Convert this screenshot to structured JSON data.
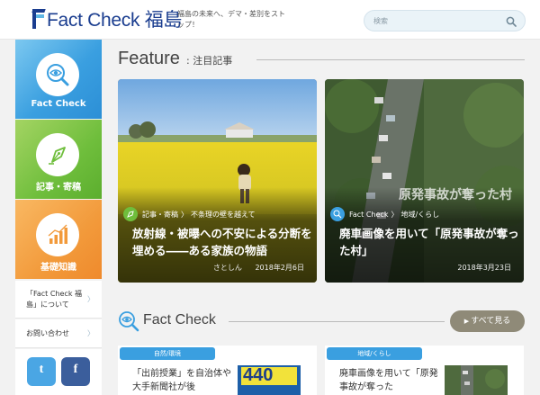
{
  "header": {
    "logo_text": "Fact Check 福島",
    "tagline": "福島の未来へ、デマ・差別をストップ！",
    "search_placeholder": "検索",
    "icons": {
      "search": "search-icon"
    }
  },
  "sidebar": {
    "categories": [
      {
        "label": "Fact Check",
        "icon": "magnifier-eye-icon",
        "color": "#3a9fe0"
      },
      {
        "label": "記事・寄稿",
        "icon": "pen-nib-icon",
        "color": "#6fbe3c"
      },
      {
        "label": "基礎知識",
        "icon": "bar-chart-icon",
        "color": "#f29a3b"
      }
    ],
    "links": [
      {
        "label": "「Fact Check 福島」について",
        "icon": "chevron-right-icon"
      },
      {
        "label": "お問い合わせ",
        "icon": "chevron-right-icon"
      }
    ],
    "social": {
      "twitter": "t",
      "facebook": "f"
    }
  },
  "feature": {
    "title_en": "Feature",
    "title_jp": ": 注目記事",
    "cards": [
      {
        "category": "記事・寄稿",
        "separator": "〉",
        "subcategory": "不条理の壁を越えて",
        "title": "放射線・被曝への不安による分断を埋める――ある家族の物語",
        "author": "さとしん",
        "date": "2018年2月6日",
        "category_color": "#6fbe3c"
      },
      {
        "category": "Fact Check",
        "separator": "〉",
        "subcategory": "地域/くらし",
        "title": "廃車画像を用いて「原発事故が奪った村」",
        "author": "",
        "date": "2018年3月23日",
        "category_color": "#3a9fe0",
        "image_text": "原発事故が奪った村"
      }
    ]
  },
  "fact_check": {
    "title": "Fact Check",
    "more_label": "すべて見る",
    "items": [
      {
        "tag": "自然/環境",
        "title": "「出前授業」を自治体や大手新聞社が後",
        "thumb_text": "440"
      },
      {
        "tag": "地域/くらし",
        "title": "廃車画像を用いて「原発事故が奪った"
      }
    ]
  }
}
